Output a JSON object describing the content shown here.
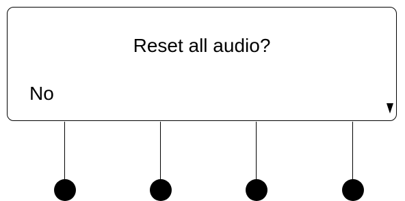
{
  "display": {
    "prompt": "Reset all audio?",
    "option": "No",
    "more_indicator_icon": "triangle-down-icon"
  },
  "soft_keys": [
    {
      "name": "soft-key-1"
    },
    {
      "name": "soft-key-2"
    },
    {
      "name": "soft-key-3"
    },
    {
      "name": "soft-key-4"
    }
  ]
}
